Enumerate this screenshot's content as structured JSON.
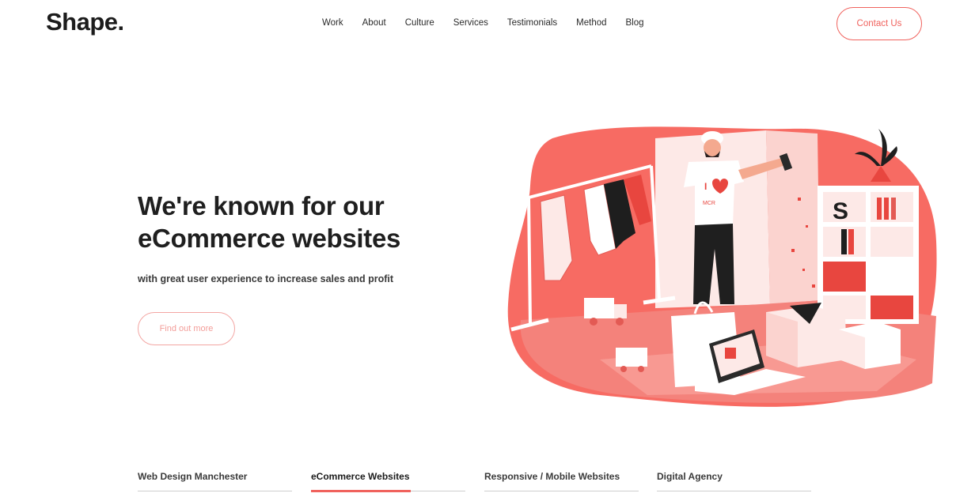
{
  "logo": "Shape.",
  "nav": [
    "Work",
    "About",
    "Culture",
    "Services",
    "Testimonials",
    "Method",
    "Blog"
  ],
  "contact_label": "Contact Us",
  "hero": {
    "title_line1": "We're known for our",
    "title_line2": "eCommerce websites",
    "subtitle": "with great user experience to increase sales and profit",
    "cta_label": "Find out more"
  },
  "illustration": {
    "shirt_text_top": "I",
    "shirt_text_bottom": "MCR",
    "shelf_letter": "S",
    "icon": "shop-owner-illustration"
  },
  "tabs": [
    {
      "label": "Web Design Manchester",
      "active": false
    },
    {
      "label": "eCommerce Websites",
      "active": true
    },
    {
      "label": "Responsive / Mobile Websites",
      "active": false
    },
    {
      "label": "Digital Agency",
      "active": false
    }
  ],
  "colors": {
    "accent": "#f0625d",
    "accent_light": "#f7a8a5",
    "text": "#1f1f1f"
  }
}
